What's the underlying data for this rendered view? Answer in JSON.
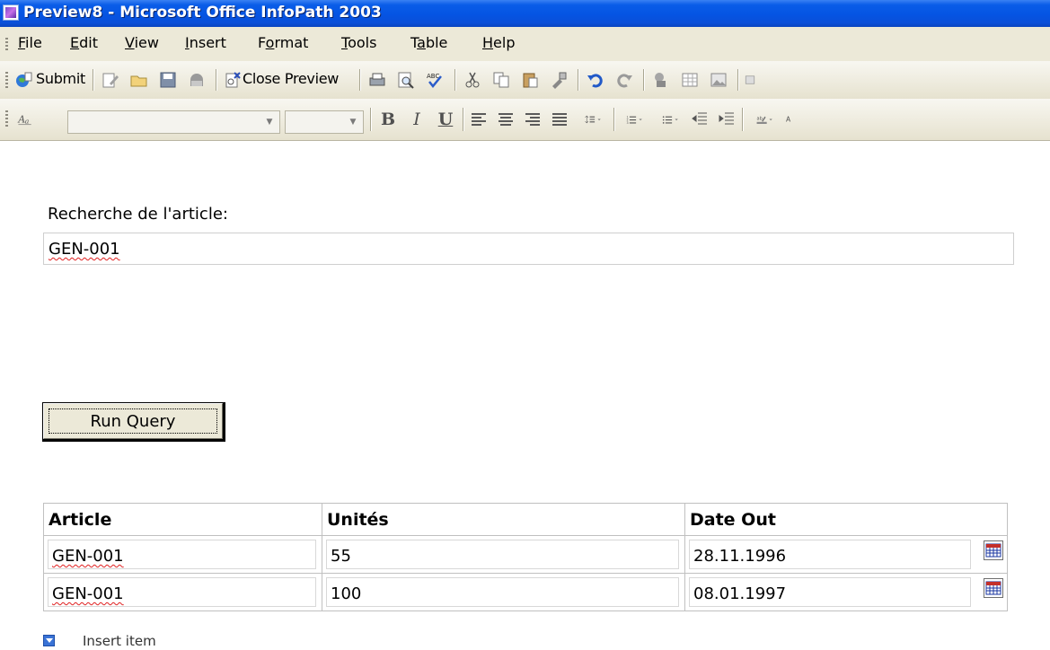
{
  "window": {
    "title": "Preview8 - Microsoft Office InfoPath 2003"
  },
  "menu": {
    "items": [
      {
        "label": "File",
        "mnemonic": "F"
      },
      {
        "label": "Edit",
        "mnemonic": "E"
      },
      {
        "label": "View",
        "mnemonic": "V"
      },
      {
        "label": "Insert",
        "mnemonic": "I"
      },
      {
        "label": "Format",
        "mnemonic": "o"
      },
      {
        "label": "Tools",
        "mnemonic": "T"
      },
      {
        "label": "Table",
        "mnemonic": "a"
      },
      {
        "label": "Help",
        "mnemonic": "H"
      }
    ]
  },
  "toolbar": {
    "submit_label": "Submit",
    "close_preview_label": "Close Preview",
    "font_name_value": "",
    "font_size_value": "",
    "icons": [
      "submit-icon",
      "edit-form-icon",
      "open-icon",
      "save-icon",
      "permission-icon",
      "close-preview-icon",
      "print-icon",
      "print-preview-icon",
      "spelling-icon",
      "cut-icon",
      "copy-icon",
      "paste-icon",
      "format-painter-icon",
      "undo-icon",
      "redo-icon",
      "digital-signature-icon",
      "insert-table-icon",
      "insert-picture-icon"
    ],
    "format_buttons": {
      "bold": "B",
      "italic": "I",
      "underline": "U"
    }
  },
  "form": {
    "search_label": "Recherche de l'article:",
    "search_value": "GEN-001",
    "run_query_label": "Run Query",
    "table": {
      "headers": [
        "Article",
        "Unités",
        "Date Out"
      ],
      "rows": [
        {
          "article": "GEN-001",
          "units": "55",
          "date": "28.11.1996"
        },
        {
          "article": "GEN-001",
          "units": "100",
          "date": "08.01.1997"
        }
      ]
    },
    "insert_item_label": "Insert item"
  },
  "colors": {
    "titlebar": "#0554e3",
    "chrome": "#ece9d8",
    "spell_underline": "#e02020"
  }
}
